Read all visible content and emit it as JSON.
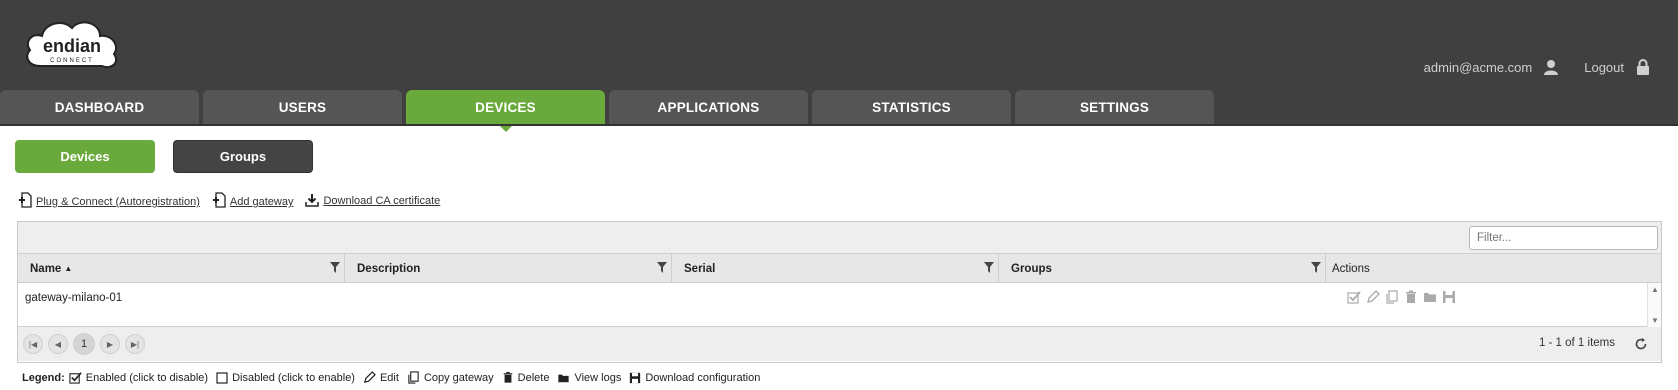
{
  "header": {
    "logo_text": "endian",
    "logo_sub": "CONNECT",
    "user_email": "admin@acme.com",
    "logout_label": "Logout"
  },
  "tabs": [
    {
      "label": "DASHBOARD",
      "active": false
    },
    {
      "label": "USERS",
      "active": false
    },
    {
      "label": "DEVICES",
      "active": true
    },
    {
      "label": "APPLICATIONS",
      "active": false
    },
    {
      "label": "STATISTICS",
      "active": false
    },
    {
      "label": "SETTINGS",
      "active": false
    }
  ],
  "subnav": {
    "devices_label": "Devices",
    "groups_label": "Groups"
  },
  "toolbar_links": {
    "plug_connect": "Plug & Connect (Autoregistration)",
    "add_gateway": "Add gateway",
    "download_ca": "Download CA certificate"
  },
  "grid": {
    "filter_placeholder": "Filter...",
    "columns": {
      "name": "Name",
      "description": "Description",
      "serial": "Serial",
      "groups": "Groups",
      "actions": "Actions"
    },
    "rows": [
      {
        "name": "gateway-milano-01",
        "description": "",
        "serial": "",
        "groups": ""
      }
    ],
    "pager": {
      "current_page": "1",
      "info": "1 - 1 of 1 items"
    }
  },
  "legend": {
    "title": "Legend:",
    "enabled": "Enabled (click to disable)",
    "disabled": "Disabled (click to enable)",
    "edit": "Edit",
    "copy": "Copy gateway",
    "delete": "Delete",
    "logs": "View logs",
    "download": "Download configuration"
  },
  "colors": {
    "header_bg": "#404040",
    "accent_green": "#6aa93b",
    "tab_bg": "#555555"
  }
}
